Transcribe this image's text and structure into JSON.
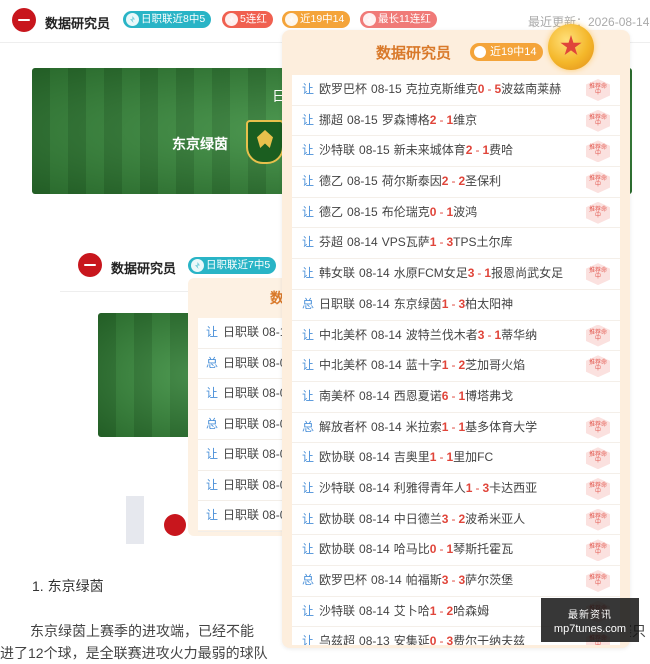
{
  "header": {
    "author": "数据研究员",
    "tags": [
      "日职联近8中5",
      "5连红",
      "近19中14",
      "最长11连红"
    ],
    "update_text": "最近更新：2026-08-14"
  },
  "banner": {
    "team": "东京绿茵",
    "overlay_char": "日"
  },
  "second_header": {
    "author": "数据研究员",
    "tag": "日职联近7中5"
  },
  "panel2": {
    "title_char": "数",
    "rows": [
      {
        "kind": "让",
        "text": "日职联 08-1"
      },
      {
        "kind": "总",
        "text": "日职联 08-0"
      },
      {
        "kind": "让",
        "text": "日职联 08-0"
      },
      {
        "kind": "总",
        "text": "日职联 08-0"
      },
      {
        "kind": "让",
        "text": "日职联 08-0"
      },
      {
        "kind": "让",
        "text": "日职联 08-0"
      },
      {
        "kind": "让",
        "text": "日职联 08-0"
      }
    ]
  },
  "article": {
    "heading": "1. 东京绿茵",
    "para": "东京绿茵上赛季的进攻端，已经不能",
    "para2": "赛只",
    "para_line2": "进了12个球，是全联赛进攻火力最弱的球队"
  },
  "main_panel": {
    "title": "数据研究员",
    "badge": "近19中14",
    "hit_label": "推荐命中",
    "rows": [
      {
        "kind": "让",
        "league": "欧罗巴杯",
        "date": "08-15",
        "home": "克拉克斯维克",
        "hs": "0",
        "as": "5",
        "away": "波兹南莱赫",
        "hit": true
      },
      {
        "kind": "让",
        "league": "挪超",
        "date": "08-15",
        "home": "罗森博格",
        "hs": "2",
        "as": "1",
        "away": "维京",
        "hit": true
      },
      {
        "kind": "让",
        "league": "沙特联",
        "date": "08-15",
        "home": "新未来城体育",
        "hs": "2",
        "as": "1",
        "away": "费哈",
        "hit": true
      },
      {
        "kind": "让",
        "league": "德乙",
        "date": "08-15",
        "home": "荷尔斯泰因",
        "hs": "2",
        "as": "2",
        "away": "圣保利",
        "hit": true
      },
      {
        "kind": "让",
        "league": "德乙",
        "date": "08-15",
        "home": "布伦瑞克",
        "hs": "0",
        "as": "1",
        "away": "波鸿",
        "hit": true
      },
      {
        "kind": "让",
        "league": "芬超",
        "date": "08-14",
        "home": "VPS瓦萨",
        "hs": "1",
        "as": "3",
        "away": "TPS土尔库",
        "hit": false
      },
      {
        "kind": "让",
        "league": "韩女联",
        "date": "08-14",
        "home": "水原FCM女足",
        "hs": "3",
        "as": "1",
        "away": "报恩尚武女足",
        "hit": true
      },
      {
        "kind": "总",
        "league": "日职联",
        "date": "08-14",
        "home": "东京绿茵",
        "hs": "1",
        "as": "3",
        "away": "柏太阳神",
        "hit": false
      },
      {
        "kind": "让",
        "league": "中北美杯",
        "date": "08-14",
        "home": "波特兰伐木者",
        "hs": "3",
        "as": "1",
        "away": "蒂华纳",
        "hit": true
      },
      {
        "kind": "让",
        "league": "中北美杯",
        "date": "08-14",
        "home": "蓝十字",
        "hs": "1",
        "as": "2",
        "away": "芝加哥火焰",
        "hit": true
      },
      {
        "kind": "让",
        "league": "南美杯",
        "date": "08-14",
        "home": "西恩夏诺",
        "hs": "6",
        "as": "1",
        "away": "博塔弗戈",
        "hit": false
      },
      {
        "kind": "总",
        "league": "解放者杯",
        "date": "08-14",
        "home": "米拉索",
        "hs": "1",
        "as": "1",
        "away": "基多体育大学",
        "hit": true
      },
      {
        "kind": "让",
        "league": "欧协联",
        "date": "08-14",
        "home": "吉奥里",
        "hs": "1",
        "as": "1",
        "away": "里加FC",
        "hit": true
      },
      {
        "kind": "让",
        "league": "沙特联",
        "date": "08-14",
        "home": "利雅得青年人",
        "hs": "1",
        "as": "3",
        "away": "卡达西亚",
        "hit": true
      },
      {
        "kind": "让",
        "league": "欧协联",
        "date": "08-14",
        "home": "中日德兰",
        "hs": "3",
        "as": "2",
        "away": "波希米亚人",
        "hit": true
      },
      {
        "kind": "让",
        "league": "欧协联",
        "date": "08-14",
        "home": "哈马比",
        "hs": "0",
        "as": "1",
        "away": "琴斯托霍瓦",
        "hit": true
      },
      {
        "kind": "总",
        "league": "欧罗巴杯",
        "date": "08-14",
        "home": "帕福斯",
        "hs": "3",
        "as": "3",
        "away": "萨尔茨堡",
        "hit": true
      },
      {
        "kind": "让",
        "league": "沙特联",
        "date": "08-14",
        "home": "艾卜哈",
        "hs": "1",
        "as": "2",
        "away": "哈森姆",
        "hit": true
      },
      {
        "kind": "让",
        "league": "乌兹超",
        "date": "08-13",
        "home": "安集延",
        "hs": "0",
        "as": "3",
        "away": "费尔干纳夫兹",
        "hit": true
      }
    ]
  },
  "watermark": {
    "line1": "最新资讯",
    "line2": "mp7tunes.com"
  }
}
